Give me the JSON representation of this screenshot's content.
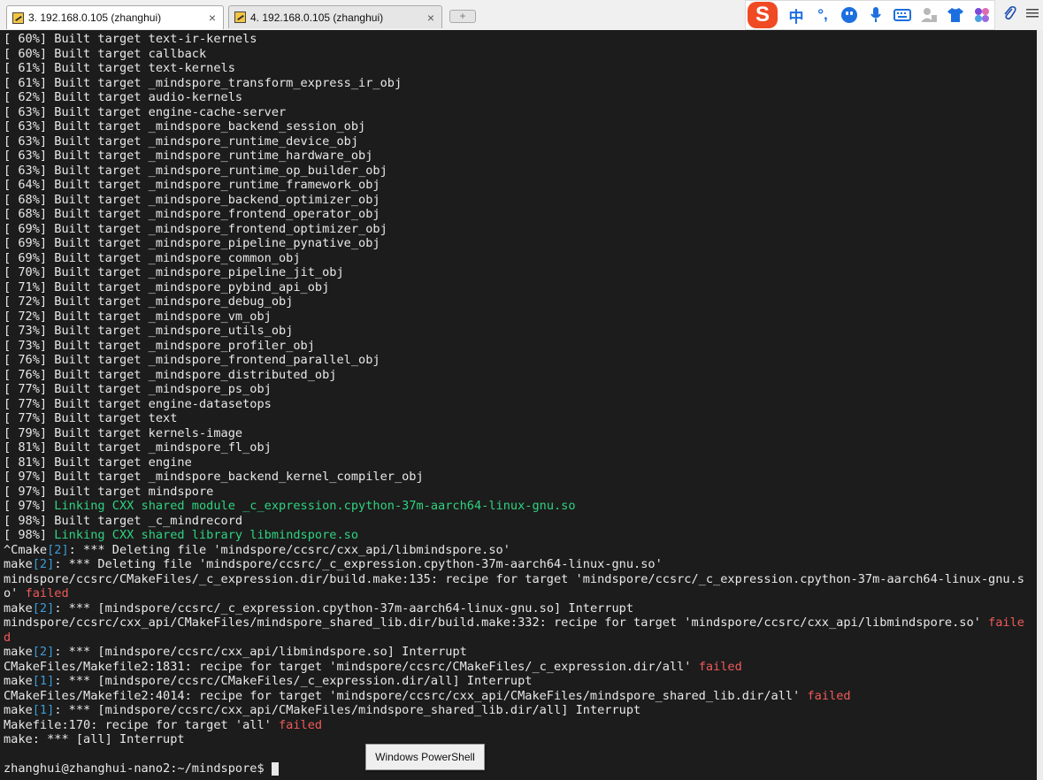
{
  "tabs": [
    {
      "label": "3. 192.168.0.105 (zhanghui)",
      "active": true,
      "close": "×"
    },
    {
      "label": "4. 192.168.0.105 (zhanghui)",
      "active": false,
      "close": "×"
    }
  ],
  "new_tab_label": "+",
  "ime": {
    "logo": "S",
    "lang": "中",
    "punct": "°,",
    "icons": [
      "emoji-icon",
      "microphone-icon",
      "keyboard-icon",
      "user-icon",
      "shirt-icon",
      "apps-icon"
    ]
  },
  "right_icons": [
    "paperclip-icon",
    "menu-icon"
  ],
  "terminal": {
    "lines": [
      {
        "segments": [
          {
            "text": "[ 60%] Built target text-ir-kernels"
          }
        ]
      },
      {
        "segments": [
          {
            "text": "[ 60%] Built target callback"
          }
        ]
      },
      {
        "segments": [
          {
            "text": "[ 61%] Built target text-kernels"
          }
        ]
      },
      {
        "segments": [
          {
            "text": "[ 61%] Built target _mindspore_transform_express_ir_obj"
          }
        ]
      },
      {
        "segments": [
          {
            "text": "[ 62%] Built target audio-kernels"
          }
        ]
      },
      {
        "segments": [
          {
            "text": "[ 63%] Built target engine-cache-server"
          }
        ]
      },
      {
        "segments": [
          {
            "text": "[ 63%] Built target _mindspore_backend_session_obj"
          }
        ]
      },
      {
        "segments": [
          {
            "text": "[ 63%] Built target _mindspore_runtime_device_obj"
          }
        ]
      },
      {
        "segments": [
          {
            "text": "[ 63%] Built target _mindspore_runtime_hardware_obj"
          }
        ]
      },
      {
        "segments": [
          {
            "text": "[ 63%] Built target _mindspore_runtime_op_builder_obj"
          }
        ]
      },
      {
        "segments": [
          {
            "text": "[ 64%] Built target _mindspore_runtime_framework_obj"
          }
        ]
      },
      {
        "segments": [
          {
            "text": "[ 68%] Built target _mindspore_backend_optimizer_obj"
          }
        ]
      },
      {
        "segments": [
          {
            "text": "[ 68%] Built target _mindspore_frontend_operator_obj"
          }
        ]
      },
      {
        "segments": [
          {
            "text": "[ 69%] Built target _mindspore_frontend_optimizer_obj"
          }
        ]
      },
      {
        "segments": [
          {
            "text": "[ 69%] Built target _mindspore_pipeline_pynative_obj"
          }
        ]
      },
      {
        "segments": [
          {
            "text": "[ 69%] Built target _mindspore_common_obj"
          }
        ]
      },
      {
        "segments": [
          {
            "text": "[ 70%] Built target _mindspore_pipeline_jit_obj"
          }
        ]
      },
      {
        "segments": [
          {
            "text": "[ 71%] Built target _mindspore_pybind_api_obj"
          }
        ]
      },
      {
        "segments": [
          {
            "text": "[ 72%] Built target _mindspore_debug_obj"
          }
        ]
      },
      {
        "segments": [
          {
            "text": "[ 72%] Built target _mindspore_vm_obj"
          }
        ]
      },
      {
        "segments": [
          {
            "text": "[ 73%] Built target _mindspore_utils_obj"
          }
        ]
      },
      {
        "segments": [
          {
            "text": "[ 73%] Built target _mindspore_profiler_obj"
          }
        ]
      },
      {
        "segments": [
          {
            "text": "[ 76%] Built target _mindspore_frontend_parallel_obj"
          }
        ]
      },
      {
        "segments": [
          {
            "text": "[ 76%] Built target _mindspore_distributed_obj"
          }
        ]
      },
      {
        "segments": [
          {
            "text": "[ 77%] Built target _mindspore_ps_obj"
          }
        ]
      },
      {
        "segments": [
          {
            "text": "[ 77%] Built target engine-datasetops"
          }
        ]
      },
      {
        "segments": [
          {
            "text": "[ 77%] Built target text"
          }
        ]
      },
      {
        "segments": [
          {
            "text": "[ 79%] Built target kernels-image"
          }
        ]
      },
      {
        "segments": [
          {
            "text": "[ 81%] Built target _mindspore_fl_obj"
          }
        ]
      },
      {
        "segments": [
          {
            "text": "[ 81%] Built target engine"
          }
        ]
      },
      {
        "segments": [
          {
            "text": "[ 97%] Built target _mindspore_backend_kernel_compiler_obj"
          }
        ]
      },
      {
        "segments": [
          {
            "text": "[ 97%] Built target mindspore"
          }
        ]
      },
      {
        "segments": [
          {
            "text": "[ 97%] "
          },
          {
            "text": "Linking CXX shared module _c_expression.cpython-37m-aarch64-linux-gnu.so",
            "c": "g"
          }
        ]
      },
      {
        "segments": [
          {
            "text": "[ 98%] Built target _c_mindrecord"
          }
        ]
      },
      {
        "segments": [
          {
            "text": "[ 98%] "
          },
          {
            "text": "Linking CXX shared library libmindspore.so",
            "c": "g"
          }
        ]
      },
      {
        "segments": [
          {
            "text": "^Cmake"
          },
          {
            "text": "[2]",
            "c": "b"
          },
          {
            "text": ": *** Deleting file 'mindspore/ccsrc/cxx_api/libmindspore.so'"
          }
        ]
      },
      {
        "segments": [
          {
            "text": "make"
          },
          {
            "text": "[2]",
            "c": "b"
          },
          {
            "text": ": *** Deleting file 'mindspore/ccsrc/_c_expression.cpython-37m-aarch64-linux-gnu.so'"
          }
        ]
      },
      {
        "segments": [
          {
            "text": "mindspore/ccsrc/CMakeFiles/_c_expression.dir/build.make:135: recipe for target 'mindspore/ccsrc/_c_expression.cpython-37m-aarch64-linux-gnu.s"
          }
        ]
      },
      {
        "segments": [
          {
            "text": "o' "
          },
          {
            "text": "failed",
            "c": "r"
          }
        ]
      },
      {
        "segments": [
          {
            "text": "make"
          },
          {
            "text": "[2]",
            "c": "b"
          },
          {
            "text": ": *** [mindspore/ccsrc/_c_expression.cpython-37m-aarch64-linux-gnu.so] Interrupt"
          }
        ]
      },
      {
        "segments": [
          {
            "text": "mindspore/ccsrc/cxx_api/CMakeFiles/mindspore_shared_lib.dir/build.make:332: recipe for target 'mindspore/ccsrc/cxx_api/libmindspore.so' "
          },
          {
            "text": "faile",
            "c": "r"
          }
        ]
      },
      {
        "segments": [
          {
            "text": "d",
            "c": "r"
          }
        ]
      },
      {
        "segments": [
          {
            "text": "make"
          },
          {
            "text": "[2]",
            "c": "b"
          },
          {
            "text": ": *** [mindspore/ccsrc/cxx_api/libmindspore.so] Interrupt"
          }
        ]
      },
      {
        "segments": [
          {
            "text": "CMakeFiles/Makefile2:1831: recipe for target 'mindspore/ccsrc/CMakeFiles/_c_expression.dir/all' "
          },
          {
            "text": "failed",
            "c": "r"
          }
        ]
      },
      {
        "segments": [
          {
            "text": "make"
          },
          {
            "text": "[1]",
            "c": "b"
          },
          {
            "text": ": *** [mindspore/ccsrc/CMakeFiles/_c_expression.dir/all] Interrupt"
          }
        ]
      },
      {
        "segments": [
          {
            "text": "CMakeFiles/Makefile2:4014: recipe for target 'mindspore/ccsrc/cxx_api/CMakeFiles/mindspore_shared_lib.dir/all' "
          },
          {
            "text": "failed",
            "c": "r"
          }
        ]
      },
      {
        "segments": [
          {
            "text": "make"
          },
          {
            "text": "[1]",
            "c": "b"
          },
          {
            "text": ": *** [mindspore/ccsrc/cxx_api/CMakeFiles/mindspore_shared_lib.dir/all] Interrupt"
          }
        ]
      },
      {
        "segments": [
          {
            "text": "Makefile:170: recipe for target 'all' "
          },
          {
            "text": "failed",
            "c": "r"
          }
        ]
      },
      {
        "segments": [
          {
            "text": "make: *** [all] Interrupt"
          }
        ]
      },
      {
        "segments": [
          {
            "text": ""
          }
        ]
      },
      {
        "segments": [
          {
            "text": "zhanghui@zhanghui-nano2:~/mindspore$ "
          }
        ],
        "cursor": true
      }
    ]
  },
  "colors": {
    "background": "#1c1c1c",
    "foreground": "#e8e8e8",
    "green": "#2fd380",
    "red": "#ef5a5a",
    "blue": "#3c9bd6"
  },
  "tooltip": "Windows PowerShell"
}
